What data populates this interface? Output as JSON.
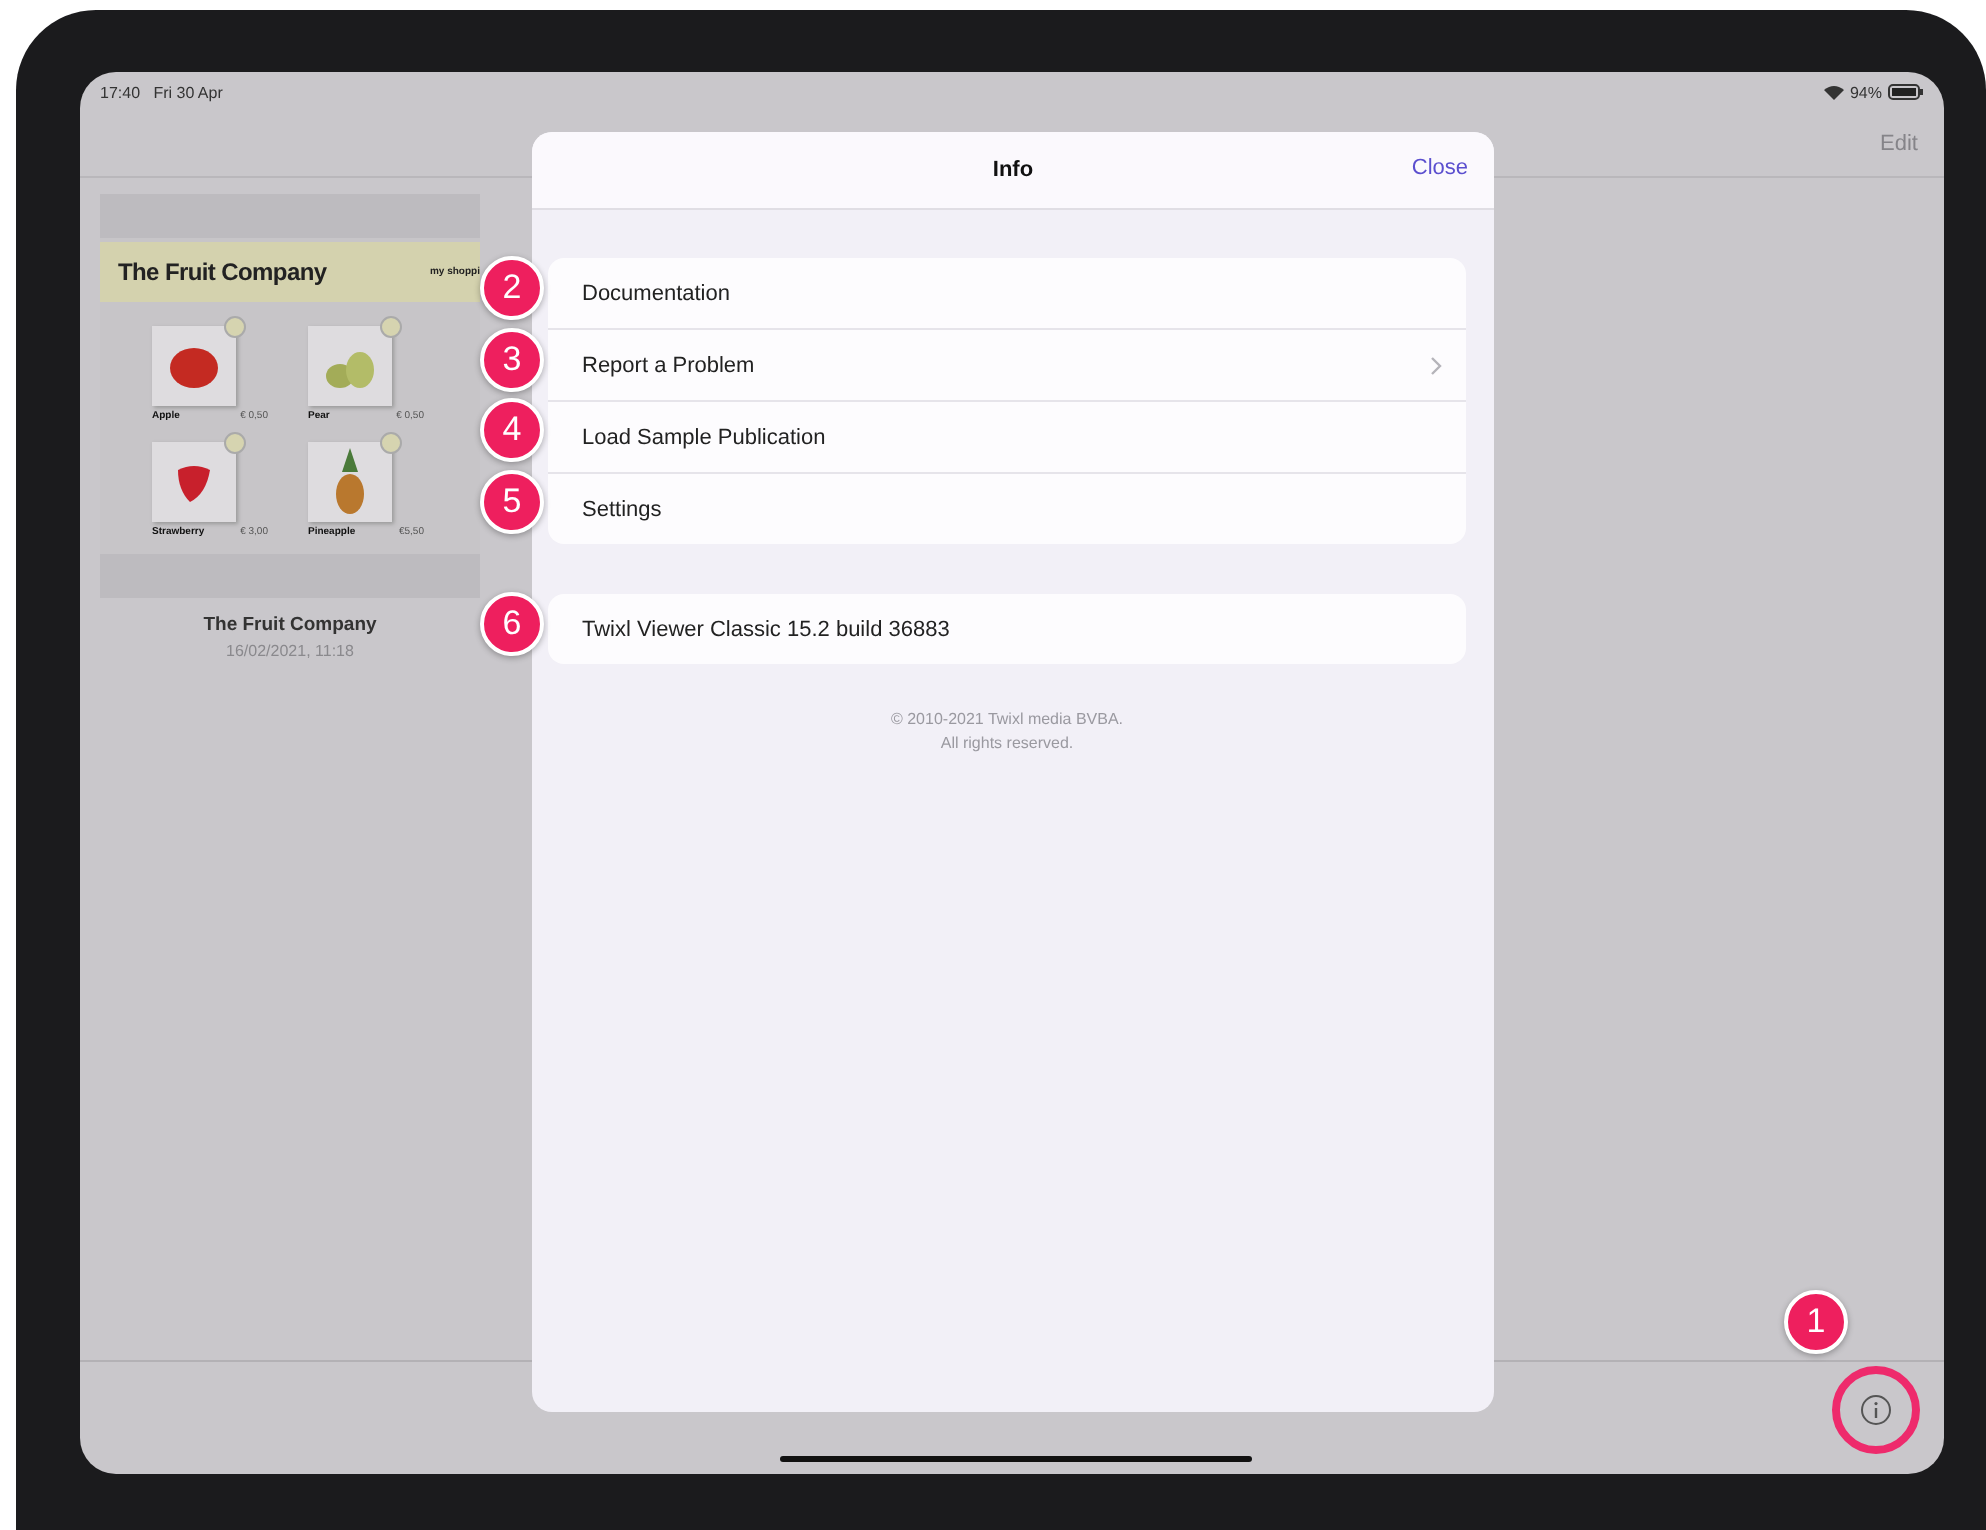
{
  "status_bar": {
    "time": "17:40",
    "date": "Fri 30 Apr",
    "battery": "94%"
  },
  "nav_bar": {
    "edit": "Edit"
  },
  "publication": {
    "banner_title": "The Fruit Company",
    "banner_tagline": "my shoppi",
    "products": [
      {
        "name": "Apple",
        "price": "€ 0,50",
        "kind": "apple"
      },
      {
        "name": "Pear",
        "price": "€ 0,50",
        "kind": "pear"
      },
      {
        "name": "Strawberry",
        "price": "€ 3,00",
        "kind": "strawberry"
      },
      {
        "name": "Pineapple",
        "price": "€5,50",
        "kind": "pineapple"
      }
    ],
    "title": "The Fruit Company",
    "date": "16/02/2021, 11:18"
  },
  "modal": {
    "title": "Info",
    "close": "Close",
    "groups": [
      [
        {
          "label": "Documentation",
          "badge": "2",
          "chevron": false
        },
        {
          "label": "Report a Problem",
          "badge": "3",
          "chevron": true
        },
        {
          "label": "Load Sample Publication",
          "badge": "4",
          "chevron": false
        },
        {
          "label": "Settings",
          "badge": "5",
          "chevron": false
        }
      ],
      [
        {
          "label": "Twixl Viewer Classic 15.2 build 36883",
          "badge": "6",
          "chevron": false
        }
      ]
    ],
    "copyright": [
      "© 2010-2021 Twixl media BVBA.",
      "All rights reserved."
    ]
  },
  "info_button": {
    "badge": "1",
    "highlighted": true
  }
}
